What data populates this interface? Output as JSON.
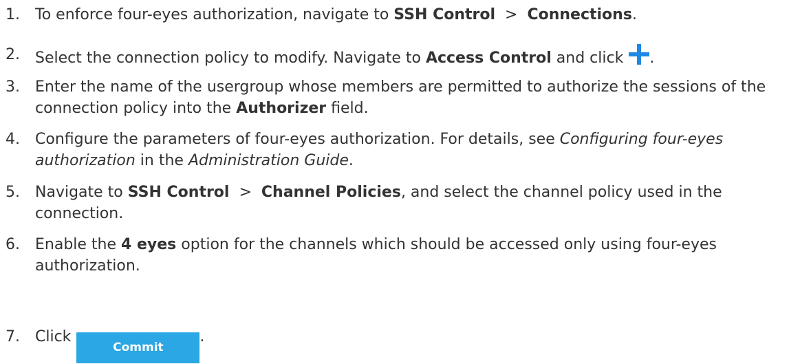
{
  "steps": [
    {
      "num": "1.",
      "t1": "To enforce four-eyes authorization, navigate to ",
      "b1": "SSH Control",
      "sep": ">",
      "b2": "Connections",
      "t2": "."
    },
    {
      "num": "2.",
      "t1": "Select the connection policy to modify. Navigate to ",
      "b1": "Access Control",
      "t2": " and click",
      "icon": "plus-icon",
      "t3": "."
    },
    {
      "num": "3.",
      "t1": "Enter the name of the usergroup whose members are permitted to authorize the sessions of the connection policy into the ",
      "b1": "Authorizer",
      "t2": " field."
    },
    {
      "num": "4.",
      "t1": "Configure the parameters of four-eyes authorization. For details, see ",
      "i1": "Configuring four-eyes authorization",
      "t2": " in the ",
      "i2": "Administration Guide",
      "t3": "."
    },
    {
      "num": "5.",
      "t1": "Navigate to ",
      "b1": "SSH Control",
      "sep": ">",
      "b2": "Channel Policies",
      "t2": ", and select the channel policy used in the connection."
    },
    {
      "num": "6.",
      "t1": "Enable the ",
      "b1": "4 eyes",
      "t2": " option for the channels which should be accessed only using four-eyes authorization."
    },
    {
      "num": "7.",
      "t1": "Click",
      "button": "Commit",
      "t2": "."
    }
  ],
  "colors": {
    "text": "#333333",
    "accent_blue": "#1e88e5",
    "commit_button": "#2aa7e4"
  }
}
